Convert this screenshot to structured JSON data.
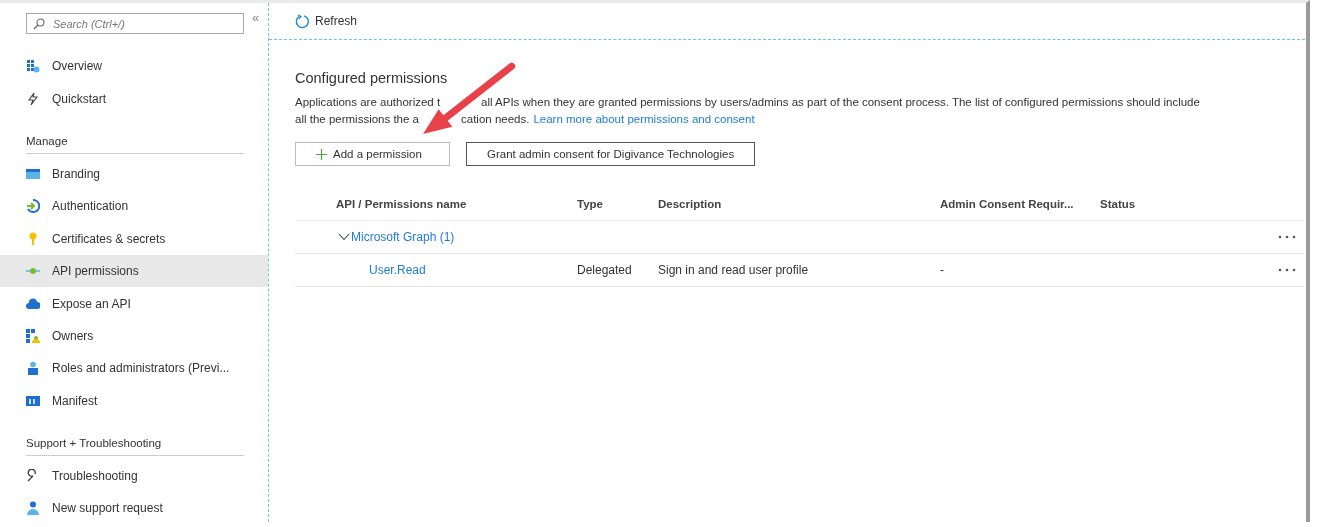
{
  "sidebar": {
    "search": {
      "placeholder": "Search (Ctrl+/)"
    },
    "collapse": "«",
    "items": [
      {
        "label": "Overview",
        "selected": false
      },
      {
        "label": "Quickstart",
        "selected": false
      }
    ],
    "sections": [
      {
        "heading": "Manage",
        "items": [
          {
            "label": "Branding",
            "selected": false
          },
          {
            "label": "Authentication",
            "selected": false
          },
          {
            "label": "Certificates & secrets",
            "selected": false
          },
          {
            "label": "API permissions",
            "selected": true
          },
          {
            "label": "Expose an API",
            "selected": false
          },
          {
            "label": "Owners",
            "selected": false
          },
          {
            "label": "Roles and administrators (Previ...",
            "selected": false
          },
          {
            "label": "Manifest",
            "selected": false
          }
        ]
      },
      {
        "heading": "Support + Troubleshooting",
        "items": [
          {
            "label": "Troubleshooting",
            "selected": false
          },
          {
            "label": "New support request",
            "selected": false
          }
        ]
      }
    ]
  },
  "toolbar": {
    "refresh": "Refresh"
  },
  "content": {
    "title": "Configured permissions",
    "description_lines": [
      {
        "before": "Applications are authorized t",
        "after": "all APIs when they are granted permissions by users/admins as part of the consent process. The list of configured permissions should include"
      },
      {
        "before": "all the permissions the a",
        "after": "cation needs."
      }
    ],
    "link": "Learn more about permissions and consent",
    "buttons": [
      {
        "label": "Add a permission",
        "kind": "add"
      },
      {
        "label": "Grant admin consent for Digivance Technologies",
        "kind": "outlined"
      }
    ],
    "table": {
      "columns": [
        "API / Permissions name",
        "Type",
        "Description",
        "Admin Consent Requir...",
        "Status"
      ],
      "rows": [
        {
          "name": "Microsoft Graph (1)",
          "expanded": true,
          "children": [
            {
              "name": "User.Read",
              "type": "Delegated",
              "description": "Sign in and read user profile",
              "admin_consent": "-"
            }
          ]
        }
      ]
    }
  }
}
